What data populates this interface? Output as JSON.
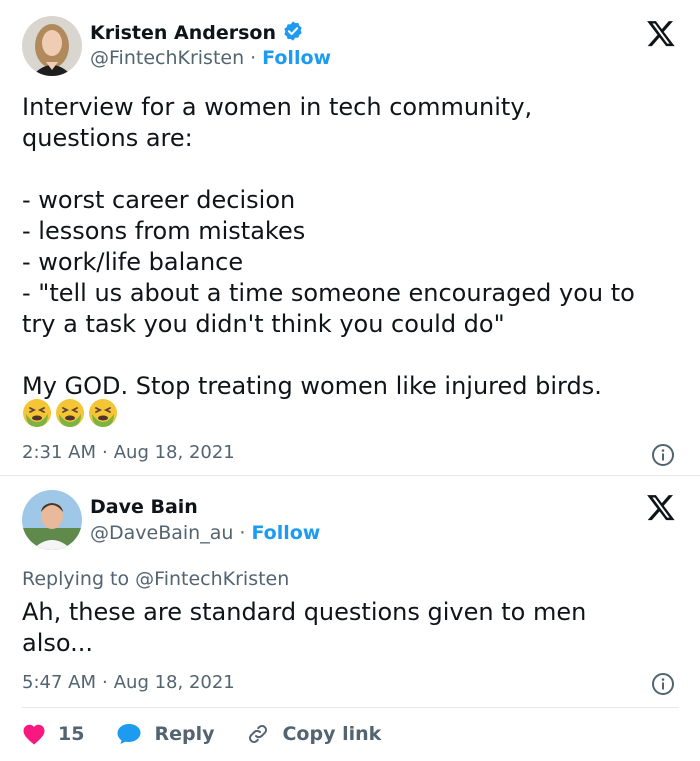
{
  "tweet1": {
    "name": "Kristen Anderson",
    "handle": "@FintechKristen",
    "separator": "·",
    "follow": "Follow",
    "text": "Interview for a women in tech community,\nquestions are:\n\n- worst career decision\n- lessons from mistakes\n- work/life balance\n- \"tell us about a time someone encouraged you to\ntry a task you didn't think you could do\"\n\nMy GOD. Stop treating women like injured birds.",
    "emoji_icons": [
      "nauseated-face-icon",
      "nauseated-face-icon",
      "nauseated-face-icon"
    ],
    "time": "2:31 AM",
    "date": "Aug 18, 2021"
  },
  "tweet2": {
    "name": "Dave Bain",
    "handle": "@DaveBain_au",
    "separator": "·",
    "follow": "Follow",
    "replying_to": "Replying to @FintechKristen",
    "text": "Ah, these are standard questions given to men\nalso...",
    "time": "5:47 AM",
    "date": "Aug 18, 2021"
  },
  "actions": {
    "likes": "15",
    "reply": "Reply",
    "copy_link": "Copy link"
  },
  "colors": {
    "accent": "#1d9bf0",
    "like": "#f91880",
    "muted": "#536471",
    "text": "#0f1419"
  }
}
